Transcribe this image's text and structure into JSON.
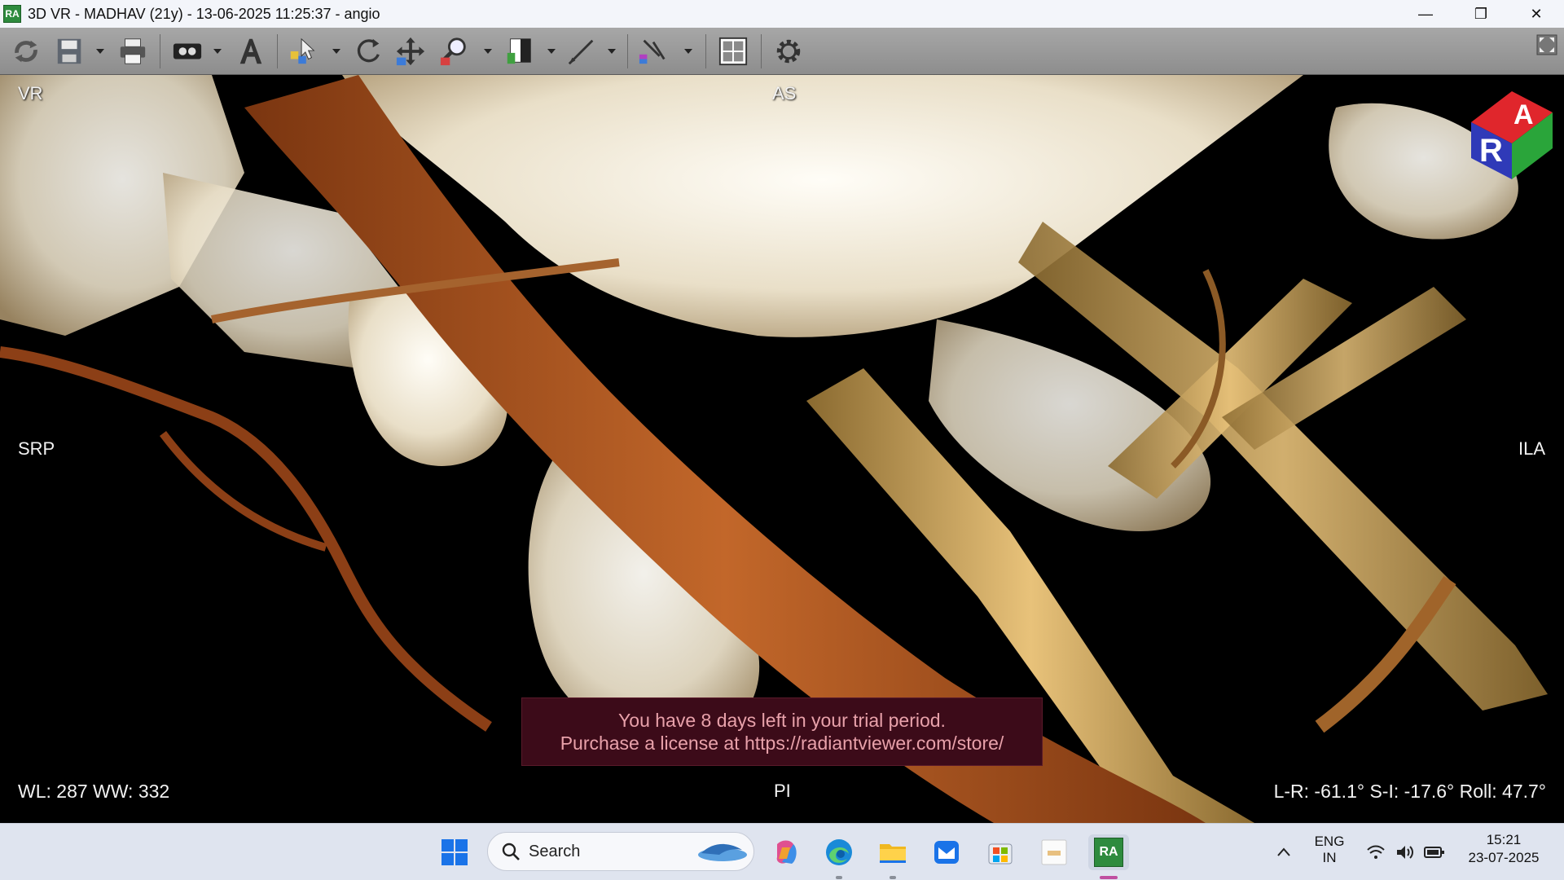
{
  "window": {
    "title": "3D VR - MADHAV (21y) - 13-06-2025 11:25:37 - angio",
    "app_icon_text": "RA",
    "minimize": "—",
    "restore": "❐",
    "close": "✕"
  },
  "toolbar": {
    "tools": [
      "reset-icon",
      "save-icon",
      "print-icon",
      "cine-icon",
      "text-annotation-icon",
      "select-tool-icon",
      "rotate-icon",
      "pan-icon",
      "zoom-icon",
      "window-level-icon",
      "measure-icon",
      "angle-icon",
      "layout-icon",
      "gear-icon"
    ]
  },
  "viewport": {
    "mode_label": "VR",
    "orient_top": "AS",
    "orient_left": "SRP",
    "orient_right": "ILA",
    "orient_bottom": "PI",
    "window_level": "WL: 287 WW: 332",
    "rotation": "L-R: -61.1° S-I: -17.6° Roll: 47.7°",
    "cube_letters": {
      "r": "R",
      "a": "A"
    },
    "trial_line1": "You have 8 days left in your trial period.",
    "trial_line2": "Purchase a license at https://radiantviewer.com/store/"
  },
  "taskbar": {
    "search_label": "Search",
    "lang_line1": "ENG",
    "lang_line2": "IN",
    "time": "15:21",
    "date": "23-07-2025",
    "pinned_app_text": "RA"
  },
  "colors": {
    "vessel": "#b85a22",
    "bone": "#efe6d2",
    "trial_bg": "#3c0b19",
    "trial_text": "#e8a1aa"
  }
}
